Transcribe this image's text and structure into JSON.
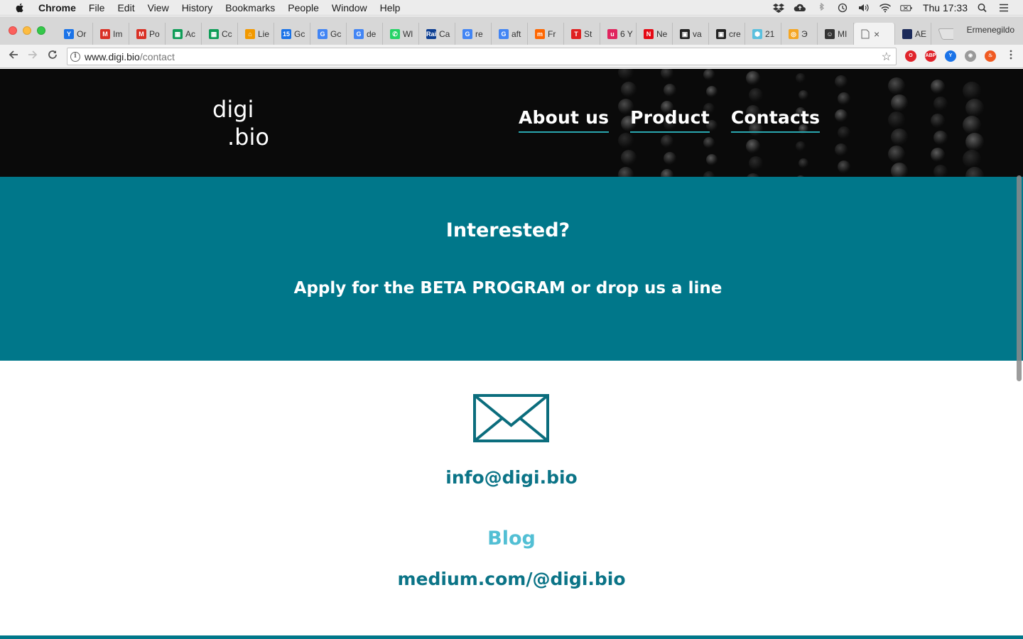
{
  "menubar": {
    "app": "Chrome",
    "items": [
      "File",
      "Edit",
      "View",
      "History",
      "Bookmarks",
      "People",
      "Window",
      "Help"
    ],
    "clock": "Thu 17:33"
  },
  "tabs": [
    {
      "label": "Or",
      "color": "#1a73e8",
      "glyph": "Y"
    },
    {
      "label": "Im",
      "color": "#d93025",
      "glyph": "M"
    },
    {
      "label": "Po",
      "color": "#d93025",
      "glyph": "M"
    },
    {
      "label": "Ac",
      "color": "#0f9d58",
      "glyph": "▦"
    },
    {
      "label": "Cc",
      "color": "#0f9d58",
      "glyph": "▦"
    },
    {
      "label": "Lie",
      "color": "#f29900",
      "glyph": "⌂"
    },
    {
      "label": "Gc",
      "color": "#1a73e8",
      "glyph": "15"
    },
    {
      "label": "Gc",
      "color": "#4285f4",
      "glyph": "G"
    },
    {
      "label": "de",
      "color": "#4285f4",
      "glyph": "G"
    },
    {
      "label": "Wl",
      "color": "#25d366",
      "glyph": "✆"
    },
    {
      "label": "Ca",
      "color": "#0b3d91",
      "glyph": "Rai"
    },
    {
      "label": "re",
      "color": "#4285f4",
      "glyph": "G"
    },
    {
      "label": "aft",
      "color": "#4285f4",
      "glyph": "G"
    },
    {
      "label": "Fr",
      "color": "#ff6600",
      "glyph": "m"
    },
    {
      "label": "St",
      "color": "#e02020",
      "glyph": "T"
    },
    {
      "label": "6 Y",
      "color": "#e0245e",
      "glyph": "u"
    },
    {
      "label": "Ne",
      "color": "#e50914",
      "glyph": "N"
    },
    {
      "label": "va",
      "color": "#222222",
      "glyph": "▣"
    },
    {
      "label": "cre",
      "color": "#222222",
      "glyph": "▣"
    },
    {
      "label": "21",
      "color": "#5bc0de",
      "glyph": "⬢"
    },
    {
      "label": "Э",
      "color": "#f5a623",
      "glyph": "◎"
    },
    {
      "label": "MI",
      "color": "#333333",
      "glyph": "☺"
    }
  ],
  "active_tab": {
    "label": "",
    "close": "×"
  },
  "last_tab": {
    "label": "AE",
    "color": "#1b2a5a"
  },
  "profile_name": "Ermenegildo",
  "address": {
    "host": "www.digi.bio",
    "path": "/contact"
  },
  "site": {
    "logo_line1": "digi",
    "logo_line2": ".bio",
    "nav": [
      "About us",
      "Product",
      "Contacts"
    ],
    "banner_title": "Interested?",
    "banner_subtitle": "Apply for the BETA PROGRAM or drop us a line",
    "email": "info@digi.bio",
    "blog_title": "Blog",
    "blog_link": "medium.com/@digi.bio"
  },
  "colors": {
    "teal": "#00778a",
    "link": "#0b7487",
    "blog_accent": "#52bfd4",
    "nav_underline": "#2aa7b0"
  },
  "extensions": [
    {
      "name": "opera-icon",
      "color": "#e0242b",
      "glyph": "O"
    },
    {
      "name": "adblock-icon",
      "color": "#e0242b",
      "glyph": "ABP"
    },
    {
      "name": "y-extension-icon",
      "color": "#1a73e8",
      "glyph": "Y"
    },
    {
      "name": "camera-icon",
      "color": "#9a9a9a",
      "glyph": "◉"
    },
    {
      "name": "fire-icon",
      "color": "#f05a22",
      "glyph": "♨"
    }
  ]
}
